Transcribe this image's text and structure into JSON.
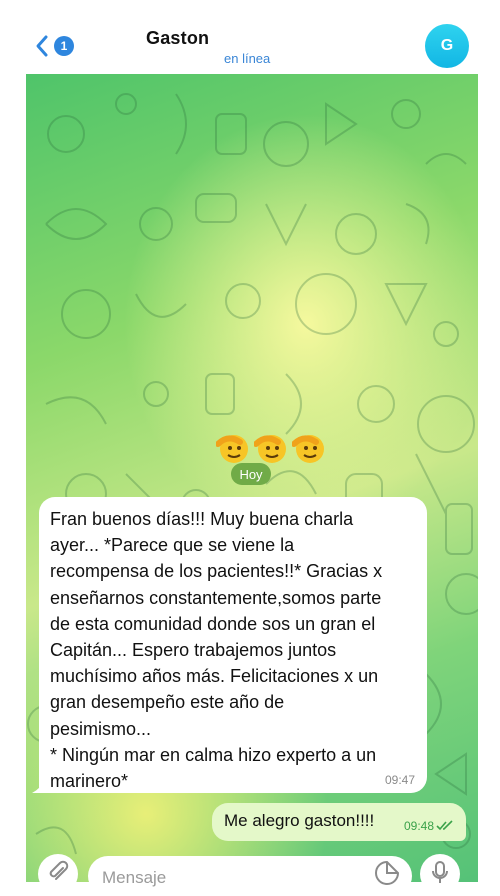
{
  "header": {
    "back_badge": "1",
    "contact_name": "Gaston ",
    "status": "en línea",
    "avatar_initial": "G"
  },
  "chat": {
    "date_label": "Hoy",
    "emoji_sticker": [
      "🫡",
      "🫡",
      "🫡"
    ],
    "messages": [
      {
        "direction": "incoming",
        "text": "Fran buenos días!!! Muy buena charla\nayer... *Parece que se viene la\nrecompensa de los pacientes!!* Gracias x\nenseñarnos constantemente,somos parte\nde esta comunidad donde sos un gran el\nCapitán... Espero trabajemos juntos\nmuchísimo años más. Felicitaciones x un\ngran desempeño este año de\npesimismo...\n* Ningún mar en calma hizo experto a un\nmarinero*",
        "time": "09:47"
      },
      {
        "direction": "outgoing",
        "text": "Me alegro gaston!!!!",
        "time": "09:48",
        "read": true
      }
    ]
  },
  "composer": {
    "placeholder": "Mensaje"
  },
  "colors": {
    "accent": "#2e86de",
    "outgoing_bubble": "#e4f8c9",
    "read_check": "#3ba24a"
  }
}
